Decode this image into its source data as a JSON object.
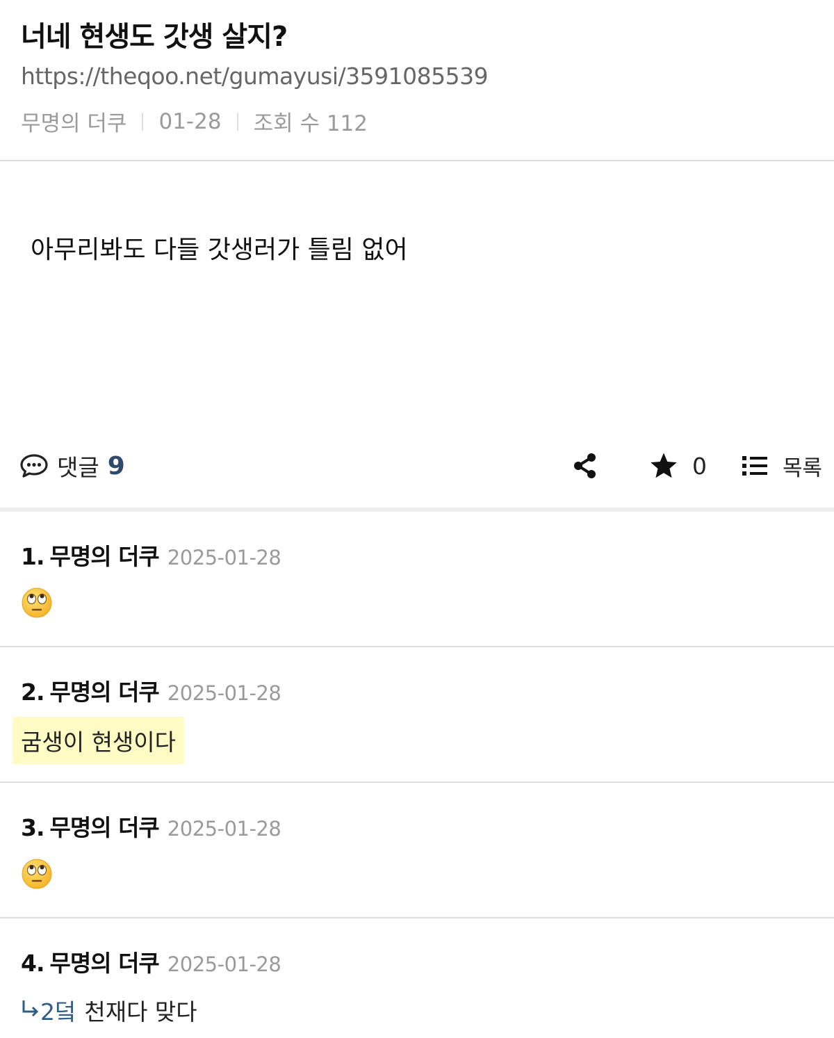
{
  "post": {
    "title": "너네 현생도 갓생 살지?",
    "url": "https://theqoo.net/gumayusi/3591085539",
    "author": "무명의 더쿠",
    "date": "01-28",
    "views_label": "조회 수 112",
    "body": "아무리봐도 다들 갓생러가 틀림 없어"
  },
  "actions": {
    "comments_label": "댓글",
    "comments_count": "9",
    "star_count": "0",
    "list_label": "목록"
  },
  "comments": [
    {
      "num": "1.",
      "author": "무명의 더쿠",
      "date": "2025-01-28",
      "emoji": "face-with-rolling-eyes"
    },
    {
      "num": "2.",
      "author": "무명의 더쿠",
      "date": "2025-01-28",
      "text": "굼생이 현생이다",
      "highlighted": true
    },
    {
      "num": "3.",
      "author": "무명의 더쿠",
      "date": "2025-01-28",
      "emoji": "face-with-rolling-eyes"
    },
    {
      "num": "4.",
      "author": "무명의 더쿠",
      "date": "2025-01-28",
      "reply_to": "2덬",
      "text": "천재다 맞다"
    }
  ],
  "colors": {
    "accent": "#2f4a6d",
    "reply_link": "#2f5f87",
    "highlight": "#fefbc4",
    "meta_text": "#9a9a9a",
    "divider": "#dddddd"
  }
}
